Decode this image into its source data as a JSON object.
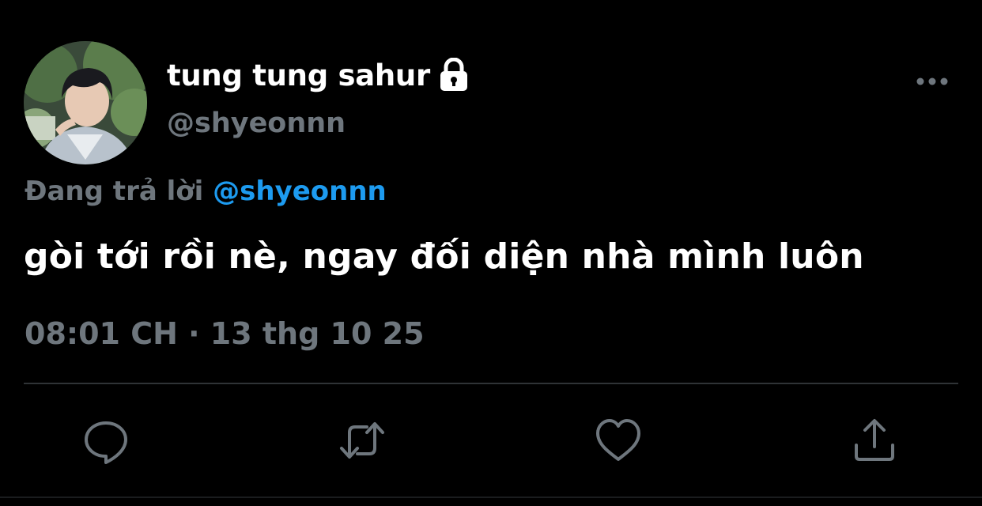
{
  "colors": {
    "background": "#000000",
    "primary_text": "#ffffff",
    "secondary_text": "#6e767d",
    "accent": "#1d9bf0",
    "divider": "#2f3336"
  },
  "author": {
    "display_name": "tung tung sahur",
    "handle": "@shyeonnn",
    "avatar_icon": "profile-photo",
    "protected_icon": "lock-icon"
  },
  "header": {
    "more_icon": "more-horizontal-icon"
  },
  "reply_context": {
    "prefix": "Đang trả lời",
    "mention": "@shyeonnn"
  },
  "tweet": {
    "text": "gòi tới rồi nè, ngay đối diện nhà mình luôn",
    "timestamp": "08:01 CH · 13 thg 10 25"
  },
  "actions": [
    {
      "name": "reply",
      "icon": "comment-icon"
    },
    {
      "name": "retweet",
      "icon": "retweet-icon"
    },
    {
      "name": "like",
      "icon": "heart-icon"
    },
    {
      "name": "share",
      "icon": "share-icon"
    }
  ]
}
